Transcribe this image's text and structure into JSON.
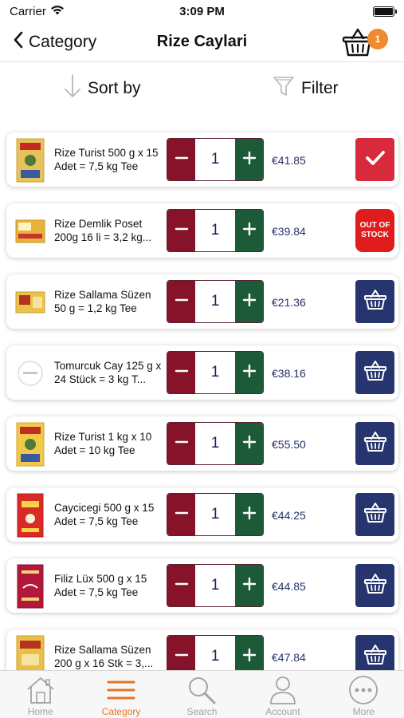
{
  "status": {
    "carrier": "Carrier",
    "time": "3:09 PM"
  },
  "nav": {
    "back_label": "Category",
    "title": "Rize Caylari",
    "cart_count": "1"
  },
  "toolbar": {
    "sort_label": "Sort by",
    "filter_label": "Filter"
  },
  "products": [
    {
      "name": "Rize  Turist 500 g x 15 Adet = 7,5 kg Tee",
      "qty": "1",
      "price": "€41.85",
      "action": "added"
    },
    {
      "name": "Rize Demlik Poset 200g 16 li = 3,2 kg...",
      "qty": "1",
      "price": "€39.84",
      "action": "out-of-stock",
      "out_of_stock_label": "OUT OF STOCK"
    },
    {
      "name": "Rize Sallama Süzen 50 g = 1,2 kg Tee",
      "qty": "1",
      "price": "€21.36",
      "action": "basket"
    },
    {
      "name": "Tomurcuk Cay 125 g x 24 Stück = 3 kg T...",
      "qty": "1",
      "price": "€38.16",
      "action": "basket"
    },
    {
      "name": "Rize Turist 1 kg x 10 Adet = 10 kg Tee",
      "qty": "1",
      "price": "€55.50",
      "action": "basket"
    },
    {
      "name": "Caycicegi 500 g x 15 Adet = 7,5 kg Tee",
      "qty": "1",
      "price": "€44.25",
      "action": "basket"
    },
    {
      "name": "Filiz Lüx 500 g x 15 Adet = 7,5 kg Tee",
      "qty": "1",
      "price": "€44.85",
      "action": "basket"
    },
    {
      "name": "Rize Sallama Süzen 200 g x 16 Stk = 3,...",
      "qty": "1",
      "price": "€47.84",
      "action": "basket"
    }
  ],
  "tabs": [
    {
      "label": "Home",
      "icon": "home-icon"
    },
    {
      "label": "Category",
      "icon": "category-icon",
      "active": true
    },
    {
      "label": "Search",
      "icon": "search-icon"
    },
    {
      "label": "Account",
      "icon": "account-icon"
    },
    {
      "label": "More",
      "icon": "more-icon"
    }
  ],
  "colors": {
    "accent": "#e37625",
    "minus": "#86132a",
    "plus": "#1d5a38",
    "basket": "#27356e",
    "added": "#d8293d",
    "out_of_stock": "#e01c1c"
  }
}
